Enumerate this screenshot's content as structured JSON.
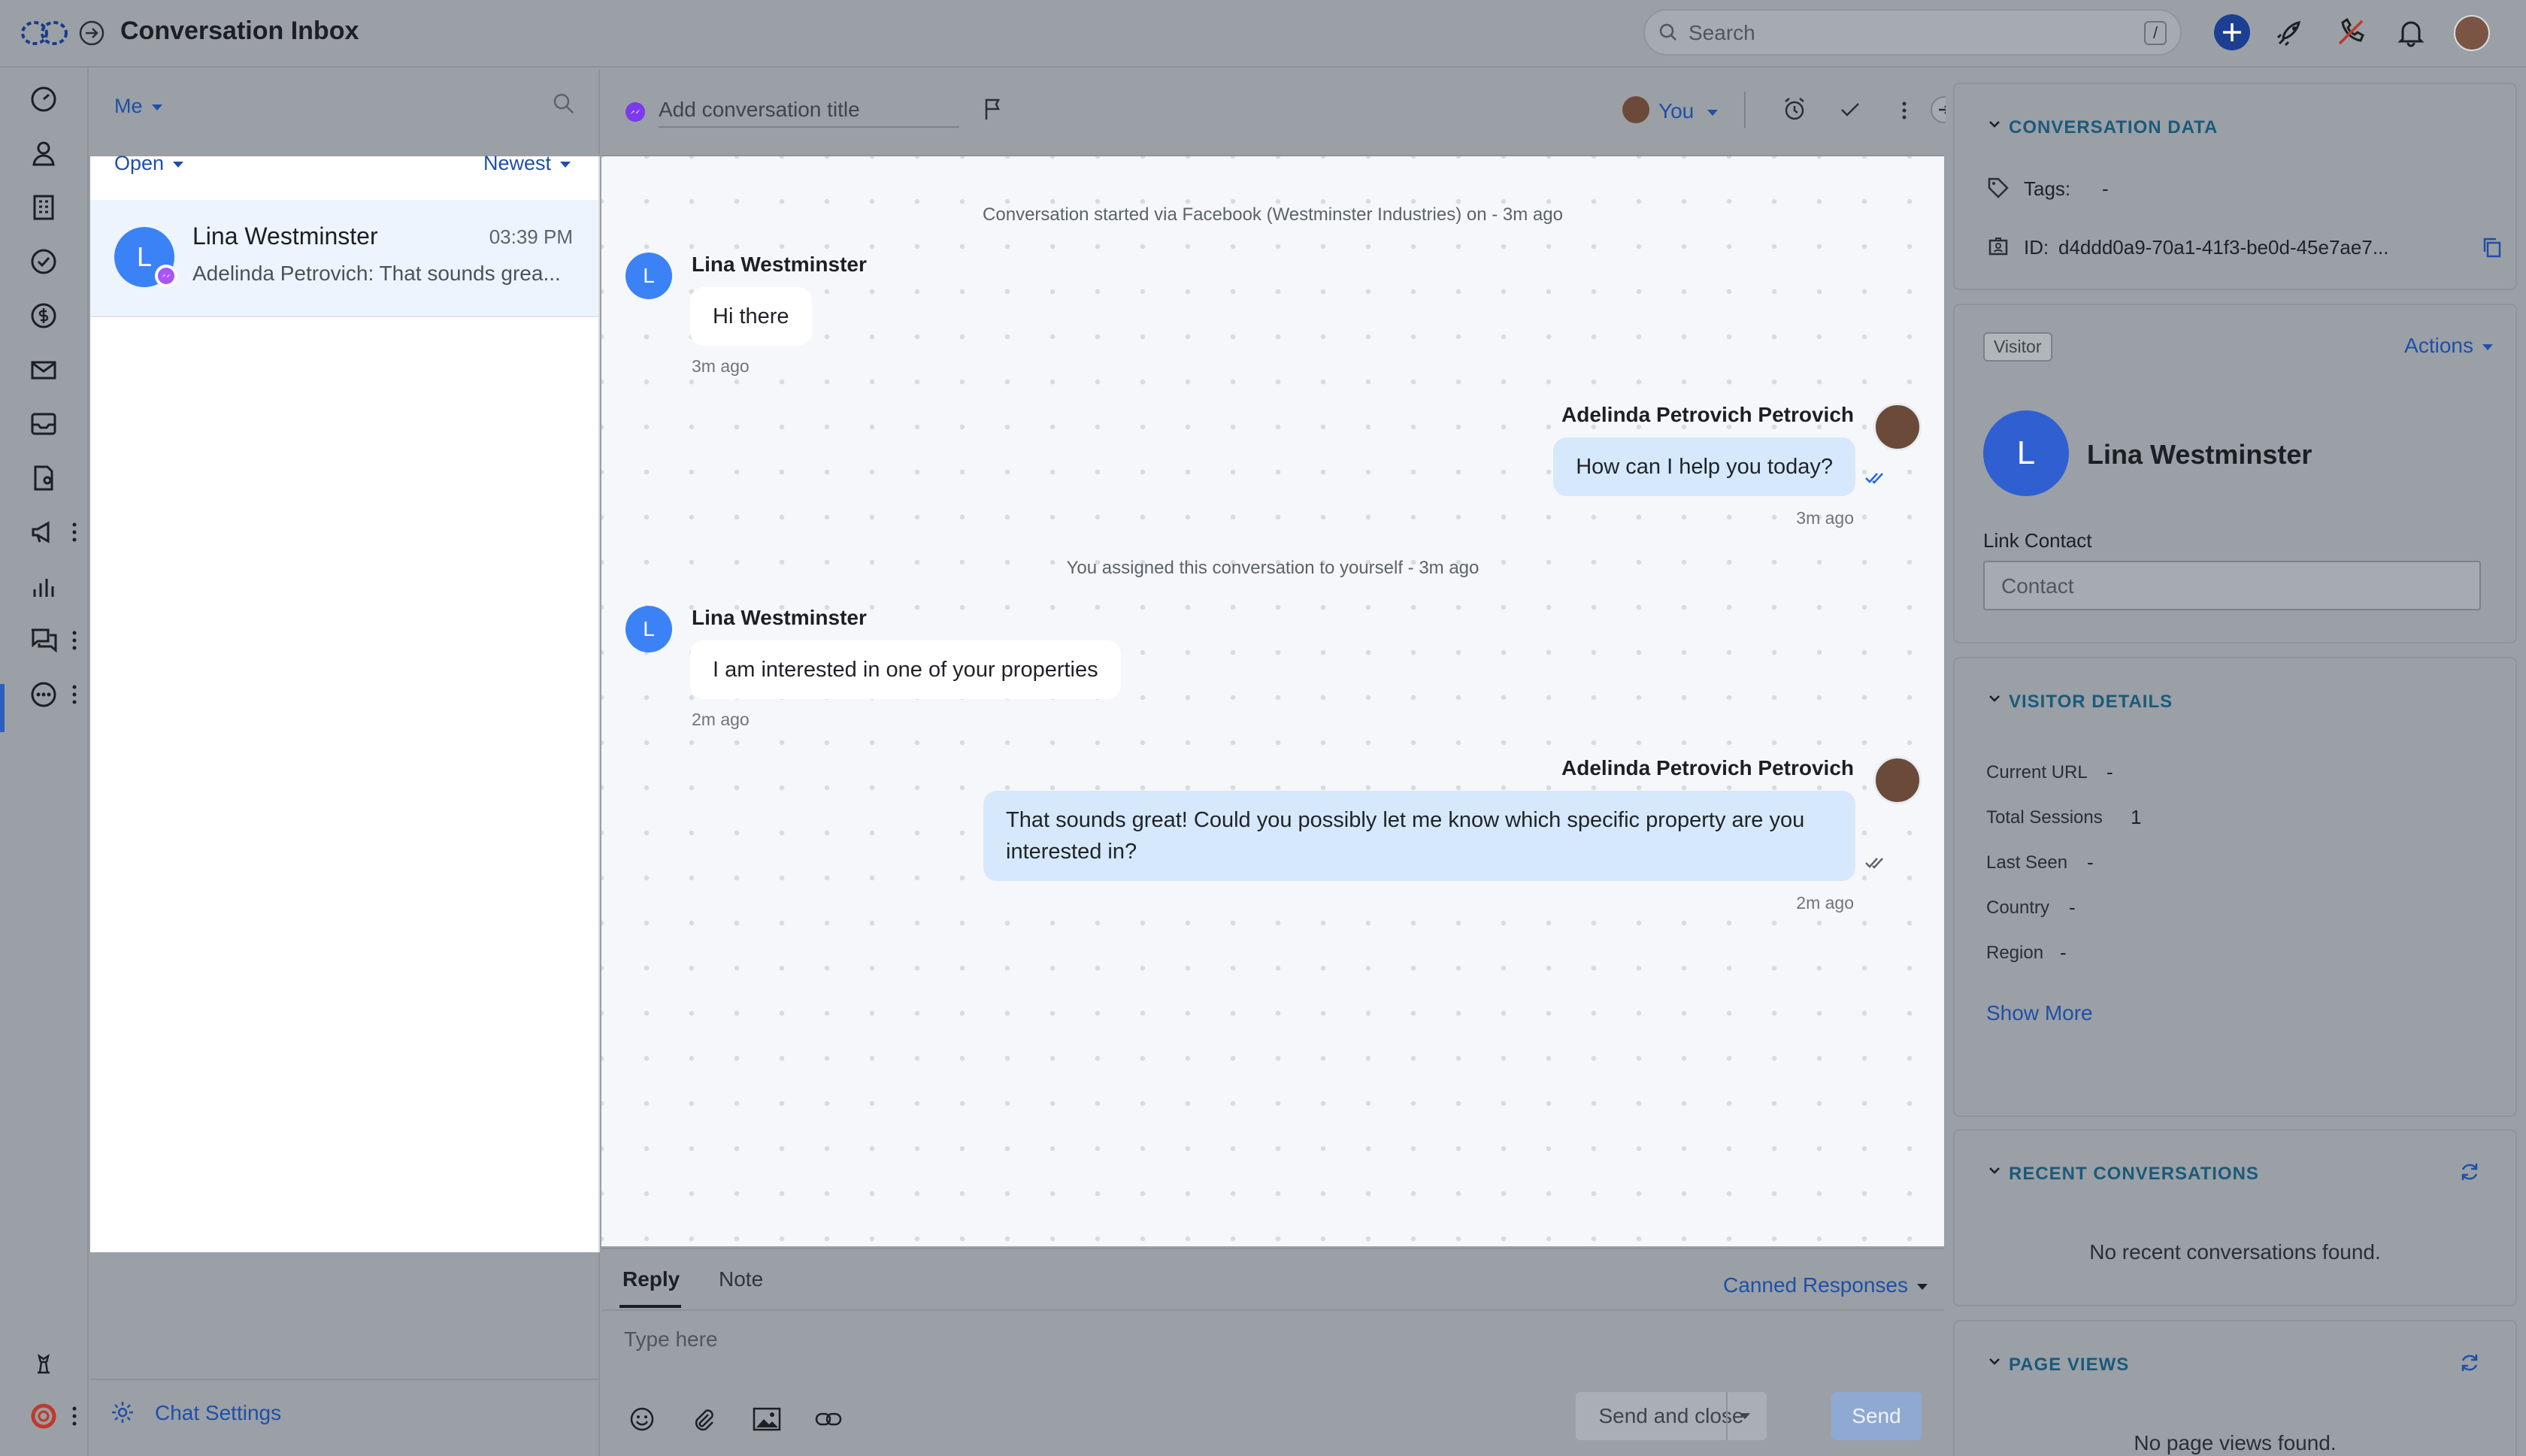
{
  "app": {
    "title": "Conversation Inbox"
  },
  "search": {
    "placeholder": "Search",
    "shortcut": "/"
  },
  "list": {
    "assignee_filter": "Me",
    "status_filter": "Open",
    "sort": "Newest",
    "conversations": [
      {
        "initial": "L",
        "name": "Lina Westminster",
        "time": "03:39 PM",
        "preview": "Adelinda Petrovich: That sounds grea..."
      }
    ],
    "footer": {
      "settings_label": "Chat Settings"
    }
  },
  "chat_header": {
    "title_placeholder": "Add conversation title",
    "assignee": "You"
  },
  "messages": {
    "start_notice": "Conversation started via Facebook (Westminster Industries) on - 3m ago",
    "m1": {
      "sender": "Lina Westminster",
      "initial": "L",
      "text": "Hi there",
      "time": "3m ago"
    },
    "m2": {
      "sender": "Adelinda Petrovich Petrovich",
      "text": "How can I help you today?",
      "time": "3m ago"
    },
    "assign_notice": "You assigned this conversation to yourself - 3m ago",
    "m3": {
      "sender": "Lina Westminster",
      "initial": "L",
      "text": "I am interested in one of your properties",
      "time": "2m ago"
    },
    "m4": {
      "sender": "Adelinda Petrovich Petrovich",
      "text": "That sounds great! Could you possibly let me know which specific property are you interested in?",
      "time": "2m ago"
    }
  },
  "composer": {
    "tab_reply": "Reply",
    "tab_note": "Note",
    "canned": "Canned Responses",
    "placeholder": "Type here",
    "send_close": "Send and close",
    "send": "Send"
  },
  "right_panel": {
    "conversation_data": {
      "title": "CONVERSATION DATA",
      "tags_label": "Tags:",
      "tags_value": "-",
      "id_label": "ID:",
      "id_value": "d4ddd0a9-70a1-41f3-be0d-45e7ae7..."
    },
    "visitor": {
      "badge": "Visitor",
      "actions": "Actions",
      "initial": "L",
      "name": "Lina Westminster",
      "link_label": "Link Contact",
      "contact_placeholder": "Contact"
    },
    "visitor_details": {
      "title": "VISITOR DETAILS",
      "current_url_label": "Current URL",
      "current_url": "-",
      "total_sessions_label": "Total Sessions",
      "total_sessions": "1",
      "last_seen_label": "Last Seen",
      "last_seen": "-",
      "country_label": "Country",
      "country": "-",
      "region_label": "Region",
      "region": "-",
      "show_more": "Show More"
    },
    "recent": {
      "title": "RECENT CONVERSATIONS",
      "empty": "No recent conversations found."
    },
    "page_views": {
      "title": "PAGE VIEWS",
      "empty": "No page views found."
    }
  },
  "colors": {
    "accent": "#1f4fa8",
    "overlay": "#9aa0a6",
    "bubble_out": "#d6e8fb",
    "avatar": "#3b82f6"
  }
}
